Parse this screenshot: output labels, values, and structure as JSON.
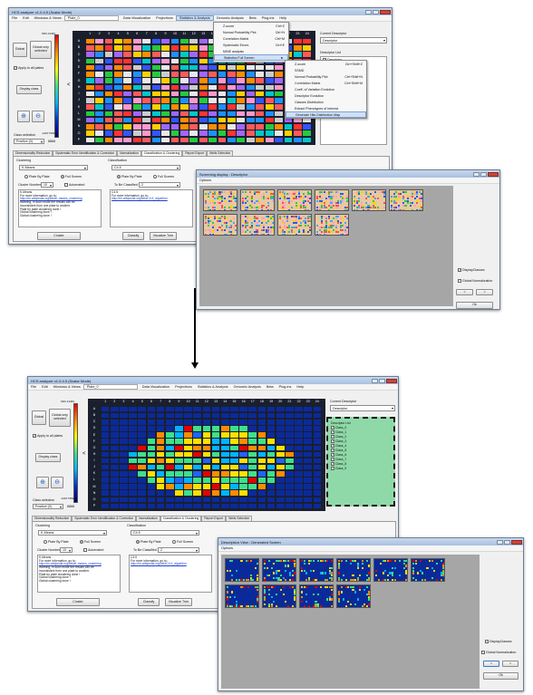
{
  "top_app": {
    "title": "HCS analyzer v1.0.4.5 (Scalar Mode)",
    "menu": [
      "File",
      "Edit",
      "Windows & Views",
      "Plate_0",
      "Data Visualization",
      "Projections",
      "Statistics & Analysis",
      "Genomic Analysis",
      "Beta",
      "Plug-ins",
      "Help"
    ],
    "left": {
      "global_btn": "Global",
      "global_only_btn": "Global only selected",
      "apply_all": "Apply to all plates",
      "display_class": "Display class",
      "scale_top": "SD0.13460",
      "scale_bottom": "-10M.75694",
      "class_selection": "Class selection",
      "class_value": "Positive (0)",
      "scale_value": "8868"
    },
    "right": {
      "current_descriptor_label": "Current Descriptor",
      "descriptor_value": "Descriptor",
      "descriptor_list_label": "Descriptor List",
      "descriptor_item": "Descriptor"
    },
    "tabs": [
      "Dimensionality Reduction",
      "Systematic Error Identification & Correction",
      "Normalization",
      "Classification & Clustering",
      "Report Export",
      "Wells Selection"
    ],
    "clustering": {
      "title": "Clustering",
      "method": "K-Means",
      "plate_by_plate": "Plate By Plate",
      "full_screen": "Full Screen",
      "cluster_number_label": "Cluster Number",
      "cluster_number": "10",
      "automated": "Automated",
      "log": [
        "K-Means",
        "For more information, go to:",
        "http://en.wikipedia.org/wiki/K-means_clustering",
        "Warning, in such mode the results can be",
        "inconsistent from one plate to another.",
        "Plate by plate clustering done !",
        "Global clustering done !",
        "Global clustering done !"
      ],
      "cluster_btn": "Cluster"
    },
    "classification": {
      "title": "Classification",
      "method": "C4.5",
      "plate_by_plate": "Plate By Plate",
      "full_screen": "Full Screen",
      "to_be_classified": "To Be Classified",
      "class_value": "2",
      "log": [
        "C4.5",
        "For more information, go to:",
        "http://en.wikipedia.org/wiki/C4.5_algorithm"
      ],
      "classify_btn": "Classify",
      "visualize_btn": "Visualize Tree"
    },
    "stats_menu": [
      {
        "label": "Z-score",
        "shortcut": "Ctrl+Z"
      },
      {
        "label": "Normal Probability Plot",
        "shortcut": "Ctrl+N"
      },
      {
        "label": "Correlation Matrix",
        "shortcut": "Ctrl+M"
      },
      {
        "label": "Systematic Errors",
        "shortcut": "Ctrl+E"
      },
      {
        "label": "MINE analysis",
        "shortcut": ""
      },
      {
        "label": "Statistics Full Screen",
        "shortcut": "►"
      }
    ],
    "sub_menu": [
      {
        "label": "Z-score",
        "shortcut": "Ctrl+Shift+Z"
      },
      {
        "label": "SSMD",
        "shortcut": ""
      },
      {
        "label": "Normal Probability Plot",
        "shortcut": "Ctrl+Shift+N"
      },
      {
        "label": "Correlation Matrix",
        "shortcut": "Ctrl+Shift+M"
      },
      {
        "label": "Coeff. of Variation Evolution",
        "shortcut": ""
      },
      {
        "label": "Descriptor Evolution",
        "shortcut": ""
      },
      {
        "label": "Classes Distribution",
        "shortcut": ""
      },
      {
        "label": "Extract Phenotypes of Interest",
        "shortcut": ""
      },
      {
        "label": "Generate Hits Distribution Map",
        "shortcut": ""
      }
    ]
  },
  "screening_dialog": {
    "title": "Screening display : Descriptor",
    "options": "Options",
    "display_classes": "DisplayClasses",
    "global_normalization": "Global Normalization",
    "prev": "<",
    "next": ">",
    "ok": "Ok"
  },
  "bottom_app": {
    "title": "HCS analyzer v1.0.4.5 (Scalar Mode)",
    "menu": [
      "File",
      "Edit",
      "Windows & Views",
      "Plate_0",
      "Data Visualization",
      "Projections",
      "Statistics & Analysis",
      "Genomic Analysis",
      "Beta",
      "Plug-ins",
      "Help"
    ],
    "left": {
      "global_btn": "Global",
      "global_only_btn": "Global only selected",
      "apply_all": "Apply to all plates",
      "display_class": "Display class",
      "scale_top": "SD0.13460",
      "scale_bottom": "-10M.75694",
      "class_selection": "Class selection",
      "class_value": "Positive (0)",
      "scale_value": "8868"
    },
    "right": {
      "current_descriptor_label": "Current Descriptor",
      "descriptor_value": "Descriptor",
      "list_header": "Descriptor List",
      "classes": [
        "Class_0",
        "Class_1",
        "Class_2",
        "Class_3",
        "Class_4",
        "Class_5",
        "Class_6",
        "Class_7",
        "Class_8",
        "Class_9"
      ]
    },
    "tabs": [
      "Dimensionality Reduction",
      "Systematic Error Identification & Correction",
      "Normalization",
      "Classification & Clustering",
      "Report Export",
      "Wells Selection"
    ],
    "clustering": {
      "title": "Clustering",
      "method": "K-Means",
      "plate_by_plate": "Plate By Plate",
      "full_screen": "Full Screen",
      "cluster_number_label": "Cluster Number",
      "cluster_number": "10",
      "automated": "Automated",
      "log": [
        "K-Means",
        "For more information, go to:",
        "http://en.wikipedia.org/wiki/K-means_clustering",
        "Warning, in such mode the results can be",
        "inconsistent from one plate to another.",
        "Plate by plate clustering done !",
        "Global clustering done !",
        "Global clustering done !"
      ],
      "cluster_btn": "Cluster"
    },
    "classification": {
      "title": "Classification",
      "method": "C4.5",
      "plate_by_plate": "Plate By Plate",
      "full_screen": "Full Screen",
      "to_be_classified": "To Be Classified",
      "class_value": "2",
      "log": [
        "C4.5",
        "For more information, go to:",
        "http://en.wikipedia.org/wiki/C4.5_algorithm"
      ],
      "classify_btn": "Classify",
      "visualize_btn": "Visualize Tree"
    }
  },
  "description_dialog": {
    "title": "Description View : Generated Screen",
    "options": "Options",
    "display_classes": "DisplayClasses",
    "global_normalization": "Global Normalization",
    "prev": "<",
    "next": ">",
    "ok": "Ok"
  },
  "plate": {
    "columns": [
      "1",
      "2",
      "3",
      "4",
      "5",
      "6",
      "7",
      "8",
      "9",
      "10",
      "11",
      "12",
      "13",
      "14",
      "15",
      "16",
      "17",
      "18",
      "19",
      "20",
      "21",
      "22",
      "23",
      "24"
    ],
    "rows": [
      "A",
      "B",
      "C",
      "D",
      "E",
      "F",
      "G",
      "H",
      "I",
      "J",
      "K",
      "L",
      "M",
      "N",
      "O",
      "P"
    ]
  }
}
